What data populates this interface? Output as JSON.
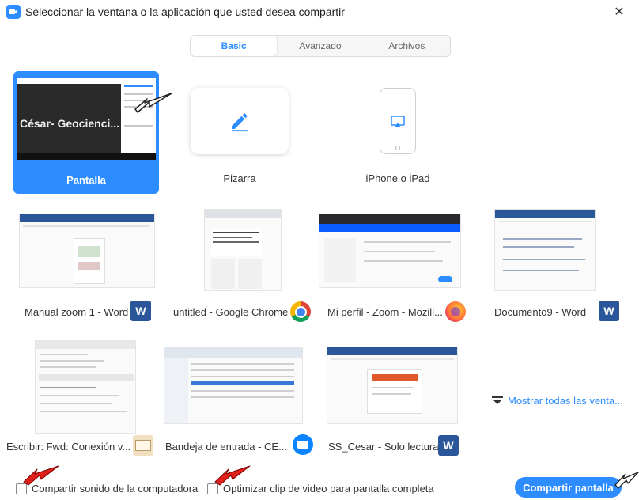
{
  "window": {
    "title": "Seleccionar la ventana o la aplicación que usted desea compartir",
    "close_glyph": "✕"
  },
  "tabs": [
    {
      "label": "Basic",
      "active": true
    },
    {
      "label": "Avanzado",
      "active": false
    },
    {
      "label": "Archivos",
      "active": false
    }
  ],
  "tiles": {
    "screen": {
      "label": "Pantalla",
      "thumb_text": "César- Geocienci...",
      "selected": true
    },
    "whiteboard": {
      "label": "Pizarra",
      "icon": "pencil-icon"
    },
    "iphone": {
      "label": "iPhone o iPad",
      "icon": "airplay-icon"
    },
    "windows": [
      {
        "label": "Manual zoom 1 - Word",
        "app": "word-icon",
        "badge_text": "W"
      },
      {
        "label": "untitled - Google Chrome",
        "app": "chrome-icon",
        "badge_text": ""
      },
      {
        "label": "Mi perfil - Zoom - Mozill...",
        "app": "firefox-icon",
        "badge_text": ""
      },
      {
        "label": "Documento9 - Word",
        "app": "word-icon",
        "badge_text": "W"
      },
      {
        "label": "Escribir: Fwd: Conexión v...",
        "app": "outlook-icon",
        "badge_text": ""
      },
      {
        "label": "Bandeja de entrada - CE...",
        "app": "thunderbird-icon",
        "badge_text": ""
      },
      {
        "label": "SS_Cesar  -  Solo lectura ...",
        "app": "word-icon",
        "badge_text": "W"
      }
    ]
  },
  "show_all": {
    "label": "Mostrar todas las venta..."
  },
  "footer": {
    "share_sound": {
      "label": "Compartir sonido de la computadora",
      "checked": false
    },
    "optimize_video": {
      "label": "Optimizar clip de video para pantalla completa",
      "checked": false
    },
    "share_button": "Compartir pantalla"
  },
  "colors": {
    "accent": "#2d8cff",
    "word": "#2b579a",
    "annotation_arrow": "#e0201a"
  }
}
